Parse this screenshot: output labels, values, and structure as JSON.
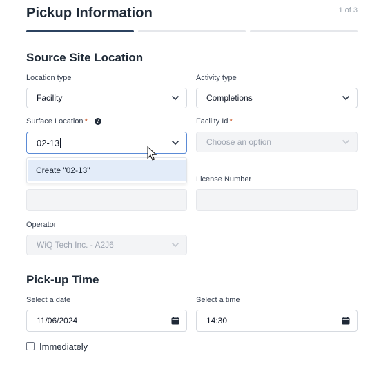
{
  "page": {
    "title": "Pickup Information",
    "step": "1 of 3"
  },
  "progress": {
    "current_step": 1,
    "total_steps": 3
  },
  "source": {
    "heading": "Source Site Location",
    "location_type": {
      "label": "Location type",
      "value": "Facility"
    },
    "activity_type": {
      "label": "Activity type",
      "value": "Completions"
    },
    "surface_location": {
      "label": "Surface Location",
      "required_mark": "*",
      "value": "02-13",
      "info_icon": "info-circle-icon"
    },
    "facility_id": {
      "label": "Facility Id",
      "required_mark": "*",
      "placeholder": "Choose an option"
    },
    "dropdown_option": "Create \"02-13\"",
    "license_number": {
      "label": "License Number",
      "value": ""
    },
    "hidden_field": {
      "value": ""
    },
    "operator": {
      "label": "Operator",
      "value": "WiQ Tech Inc. - A2J6"
    }
  },
  "pickup": {
    "heading": "Pick-up Time",
    "date": {
      "label": "Select a date",
      "value": "11/06/2024"
    },
    "time": {
      "label": "Select a time",
      "value": "14:30"
    },
    "immediately": {
      "label": "Immediately",
      "checked": false
    }
  },
  "colors": {
    "accent": "#2c4360",
    "focus_border": "#5b8bd6",
    "option_highlight": "#e3ecf9",
    "required": "#c2410c"
  }
}
